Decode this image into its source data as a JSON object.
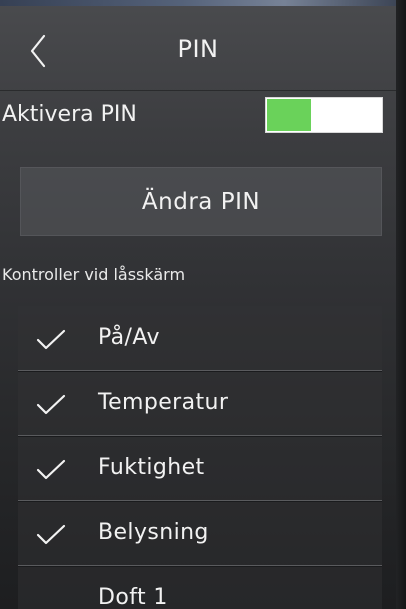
{
  "header": {
    "title": "PIN",
    "back_icon": "chevron-left-icon"
  },
  "activate_pin": {
    "label": "Aktivera PIN",
    "enabled": true,
    "on_color": "#6ad25a"
  },
  "change_pin": {
    "label": "Ändra PIN"
  },
  "lock_screen_controls": {
    "title": "Kontroller vid låsskärm",
    "items": [
      {
        "label": "På/Av",
        "checked": true
      },
      {
        "label": "Temperatur",
        "checked": true
      },
      {
        "label": "Fuktighet",
        "checked": true
      },
      {
        "label": "Belysning",
        "checked": true
      },
      {
        "label": "Doft 1",
        "checked": false
      }
    ]
  }
}
